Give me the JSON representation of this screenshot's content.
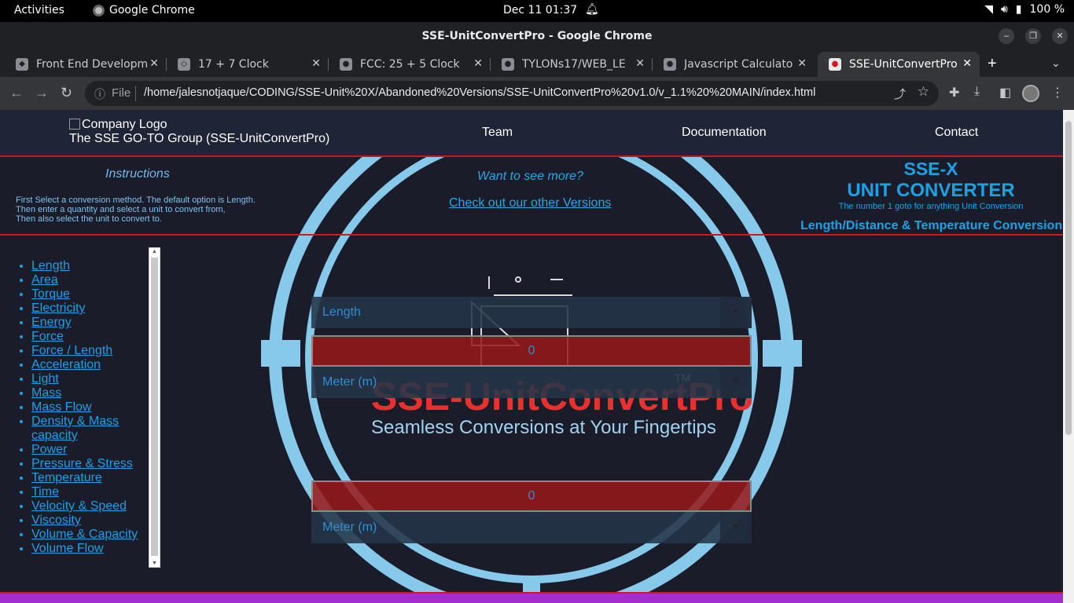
{
  "system": {
    "activities": "Activities",
    "app_name": "Google Chrome",
    "clock": "Dec 11  01:37",
    "battery": "100 %"
  },
  "window": {
    "title": "SSE-UnitConvertPro - Google Chrome"
  },
  "tabs": [
    {
      "label": "Front End Developm"
    },
    {
      "label": "17 + 7 Clock"
    },
    {
      "label": "FCC: 25 + 5 Clock"
    },
    {
      "label": "TYLONs17/WEB_LE"
    },
    {
      "label": "Javascript Calculato"
    },
    {
      "label": "SSE-UnitConvertPro"
    }
  ],
  "omnibox": {
    "scheme_label": "File",
    "url": "/home/jalesnotjaque/CODING/SSE-Unit%20X/Abandoned%20Versions/SSE-UnitConvertPro%20v1.0/v_1.1%20%20MAIN/index.html"
  },
  "header": {
    "logo_alt": "Company Logo",
    "company": "The SSE GO-TO Group (SSE-UnitConvertPro)",
    "nav": {
      "team": "Team",
      "docs": "Documentation",
      "contact": "Contact"
    }
  },
  "info": {
    "instructions_title": "Instructions",
    "instructions_lines": [
      "First Select a conversion method. The default option is Length.",
      "Then enter a quantity and select a unit to convert from,",
      "Then also select the unit to convert to."
    ],
    "want_more": "Want to see more?",
    "other_versions": "Check out our other Versions",
    "brand_line1": "SSE-X",
    "brand_line2": "UNIT CONVERTER",
    "brand_tagline": "The number 1 goto for anything Unit Conversion",
    "mode_title": "Length/Distance & Temperature Conversion"
  },
  "categories": [
    "Length",
    "Area",
    "Torque",
    "Electricity",
    "Energy",
    "Force",
    "Force / Length",
    "Acceleration",
    "Light",
    "Mass",
    "Mass Flow",
    "Density & Mass capacity",
    "Power",
    "Pressure & Stress",
    "Temperature",
    "Time",
    "Velocity & Speed",
    "Viscosity",
    "Volume & Capacity",
    "Volume Flow"
  ],
  "art": {
    "logo_text": "SSE-UnitConvertPro",
    "tm": "TM",
    "slogan": "Seamless Conversions at Your Fingertips"
  },
  "converter": {
    "method": "Length",
    "from_value": "0",
    "from_unit": "Meter (m)",
    "to_value": "0",
    "to_unit": "Meter (m)"
  },
  "colors": {
    "accent": "#19a3e5",
    "header_border": "#d2171d",
    "ring": "#86c9ea",
    "footer": "#a42ec9"
  }
}
